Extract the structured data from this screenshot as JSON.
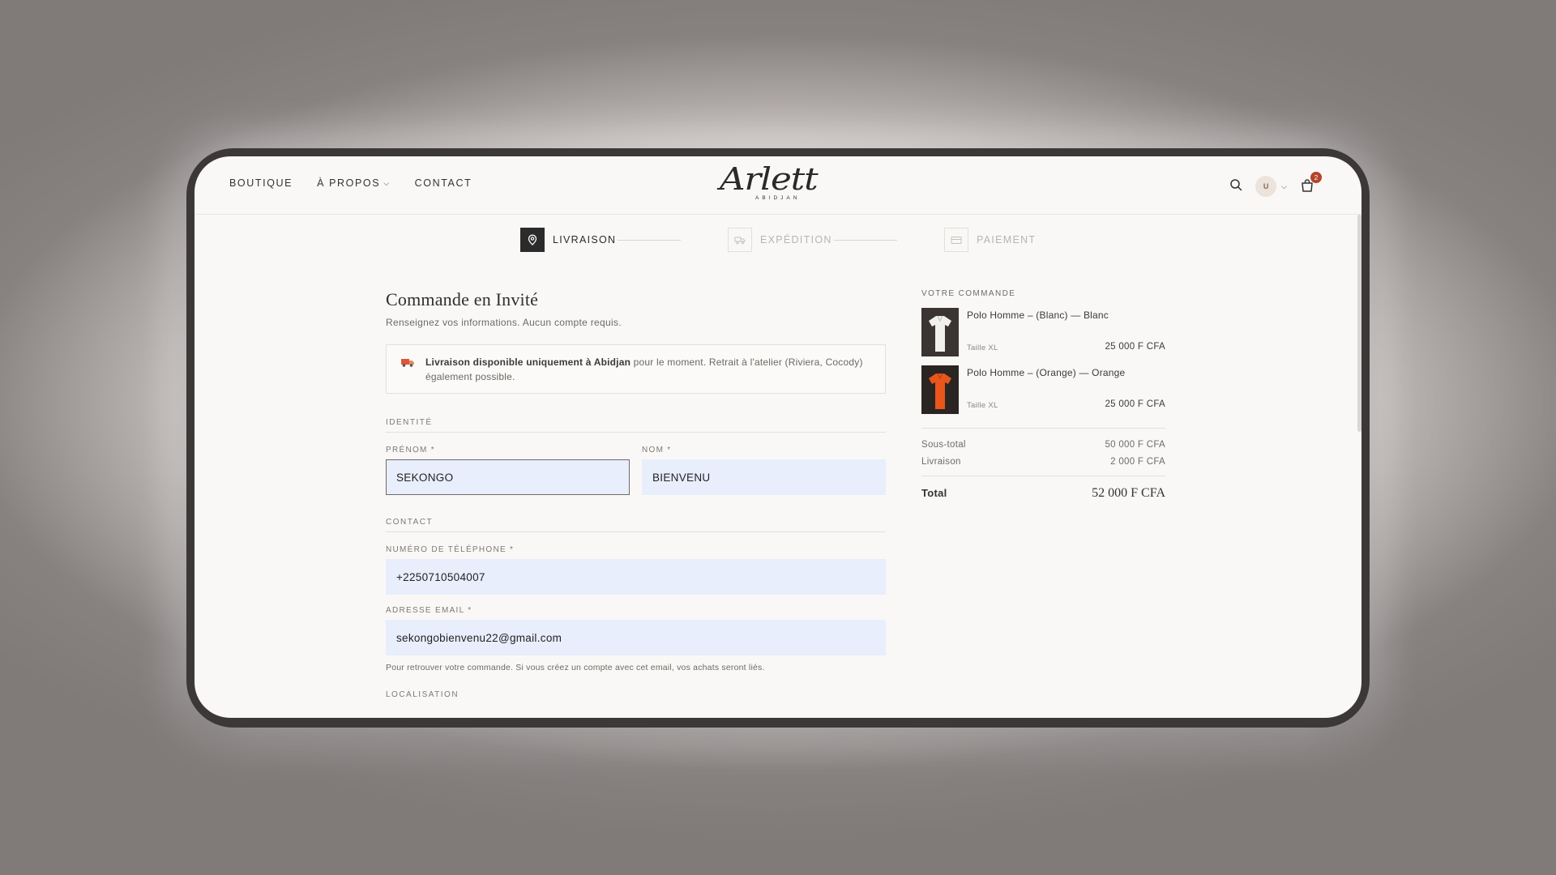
{
  "header": {
    "nav": [
      {
        "label": "BOUTIQUE"
      },
      {
        "label": "À PROPOS",
        "has_dropdown": true
      },
      {
        "label": "CONTACT"
      }
    ],
    "logo": {
      "script": "Arlett",
      "sub": "ABIDJAN"
    },
    "user_initial": "U",
    "cart_count": "2"
  },
  "steps": [
    {
      "label": "LIVRAISON",
      "icon": "location-pin-icon",
      "active": true
    },
    {
      "label": "EXPÉDITION",
      "icon": "truck-icon",
      "active": false
    },
    {
      "label": "PAIEMENT",
      "icon": "card-icon",
      "active": false
    }
  ],
  "form": {
    "title": "Commande en Invité",
    "subtitle": "Renseignez vos informations. Aucun compte requis.",
    "notice_bold": "Livraison disponible uniquement à Abidjan",
    "notice_rest": " pour le moment. Retrait à l'atelier (Riviera, Cocody) également possible.",
    "section_identity": "IDENTITÉ",
    "first_name_label": "PRÉNOM *",
    "first_name_value": "SEKONGO",
    "last_name_label": "NOM *",
    "last_name_value": "BIENVENU",
    "section_contact": "CONTACT",
    "phone_label": "NUMÉRO DE TÉLÉPHONE *",
    "phone_value": "+2250710504007",
    "email_label": "ADRESSE EMAIL *",
    "email_value": "sekongobienvenu22@gmail.com",
    "email_hint": "Pour retrouver votre commande. Si vous créez un compte avec cet email, vos achats seront liés.",
    "section_location": "LOCALISATION"
  },
  "order": {
    "title": "VOTRE COMMANDE",
    "items": [
      {
        "name": "Polo Homme – (Blanc) — Blanc",
        "size": "Taille XL",
        "price": "25 000 F CFA",
        "color": "#f1f0ee"
      },
      {
        "name": "Polo Homme – (Orange) — Orange",
        "size": "Taille XL",
        "price": "25 000 F CFA",
        "color": "#e8561c"
      }
    ],
    "subtotal_label": "Sous-total",
    "subtotal_value": "50 000 F CFA",
    "shipping_label": "Livraison",
    "shipping_value": "2 000 F CFA",
    "total_label": "Total",
    "total_value": "52 000 F CFA"
  },
  "colors": {
    "accent_dark": "#2b2b2b",
    "input_fill": "#e8eefb",
    "badge": "#b5432a"
  }
}
